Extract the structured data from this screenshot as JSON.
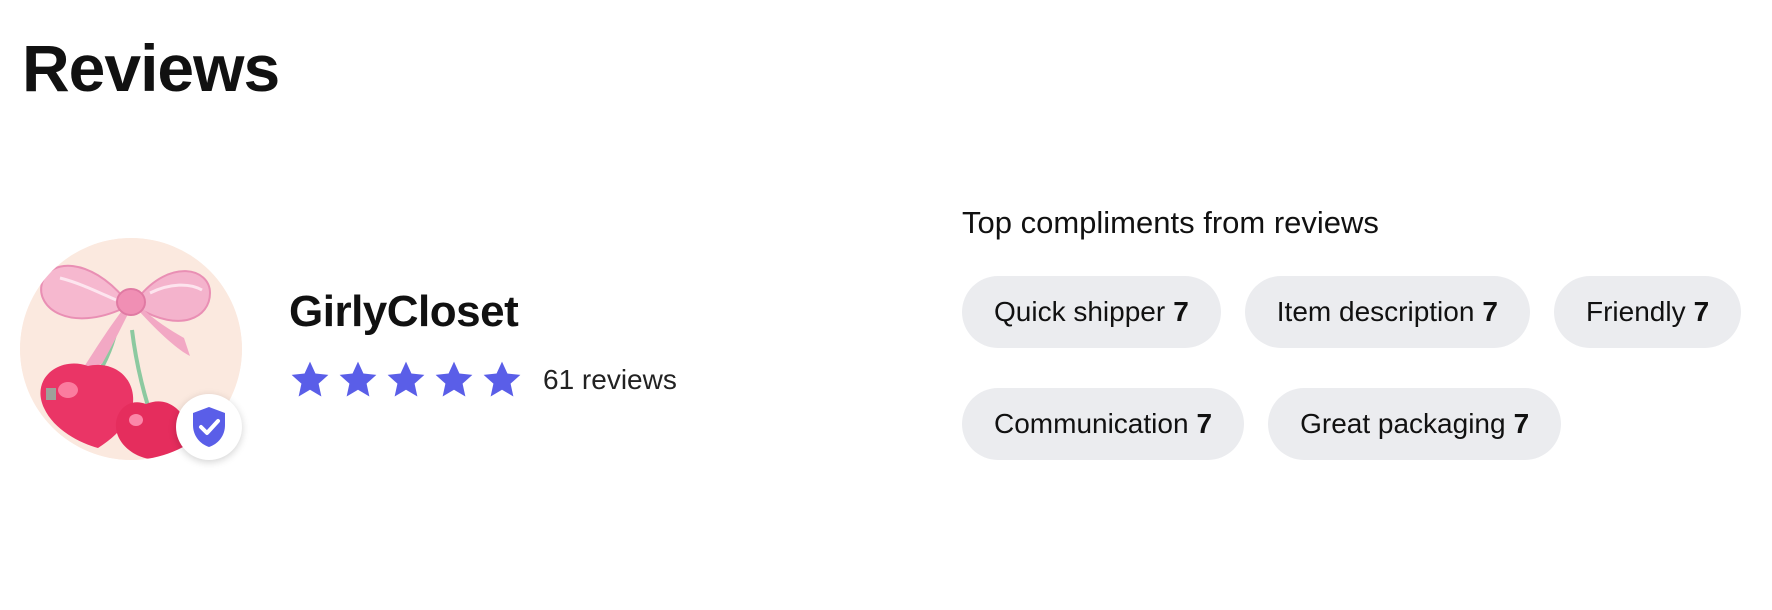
{
  "page": {
    "title": "Reviews"
  },
  "seller": {
    "name": "GirlyCloset",
    "avatar_icon": "bow-and-cherries-avatar",
    "badge_icon": "verified-shield-icon",
    "rating": 5,
    "rating_max": 5,
    "review_count_text": "61 reviews",
    "star_color": "#5a5ee8"
  },
  "compliments": {
    "heading": "Top compliments from reviews",
    "rows": [
      [
        {
          "label": "Quick shipper",
          "count": "7"
        },
        {
          "label": "Item description",
          "count": "7"
        },
        {
          "label": "Friendly",
          "count": "7"
        }
      ],
      [
        {
          "label": "Communication",
          "count": "7"
        },
        {
          "label": "Great packaging",
          "count": "7"
        }
      ]
    ],
    "chip_color": "#ebecef"
  }
}
